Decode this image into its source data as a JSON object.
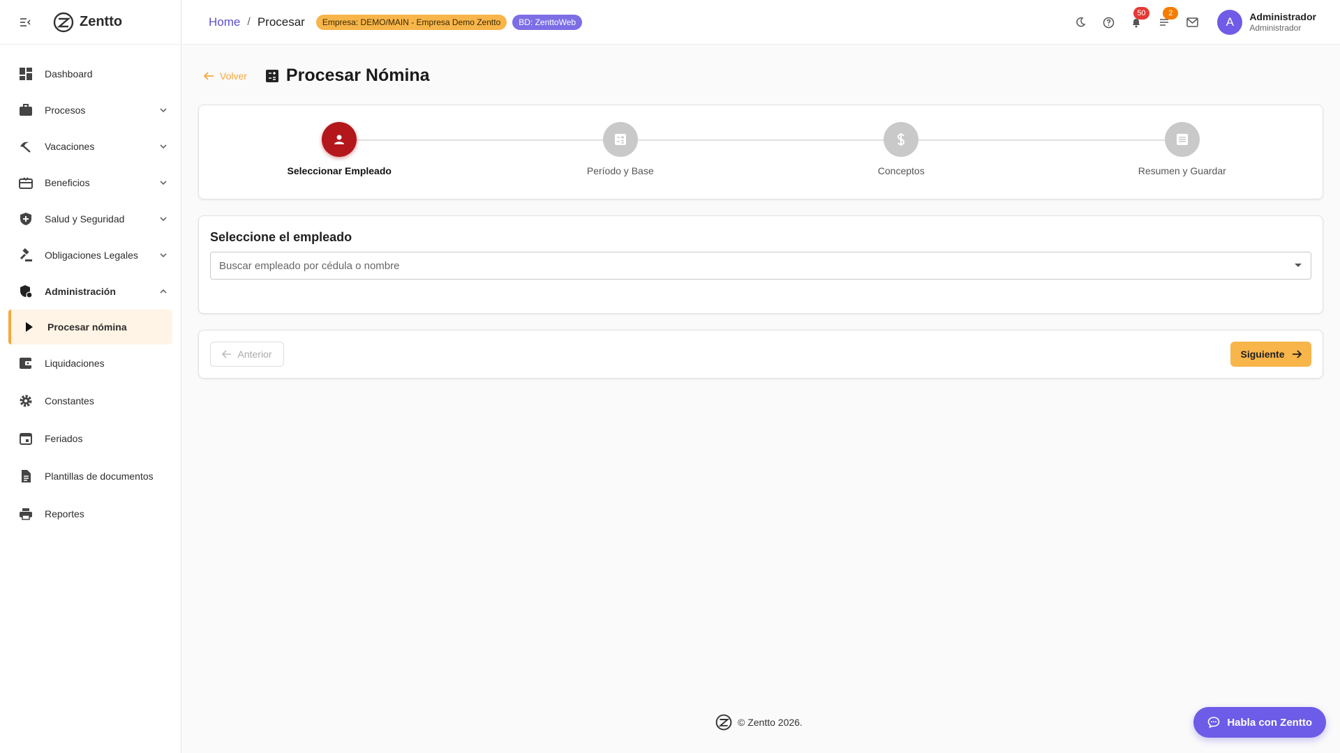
{
  "app": {
    "name": "Zentto"
  },
  "header": {
    "breadcrumb": {
      "home": "Home",
      "sep": "/",
      "current": "Procesar"
    },
    "badge_empresa": "Empresa: DEMO/MAIN - Empresa Demo Zentto",
    "badge_bd": "BD: ZenttoWeb",
    "notifications_count": "50",
    "tasks_count": "2",
    "user": {
      "initial": "A",
      "name": "Administrador",
      "role": "Administrador"
    }
  },
  "sidebar": {
    "items": [
      {
        "label": "Dashboard",
        "icon": "dashboard-icon"
      },
      {
        "label": "Procesos",
        "icon": "briefcase-icon"
      },
      {
        "label": "Vacaciones",
        "icon": "beach-icon"
      },
      {
        "label": "Beneficios",
        "icon": "gift-card-icon"
      },
      {
        "label": "Salud y Seguridad",
        "icon": "shield-icon"
      },
      {
        "label": "Obligaciones Legales",
        "icon": "gavel-icon"
      },
      {
        "label": "Administración",
        "icon": "admin-shield-icon"
      },
      {
        "label": "Procesar nómina",
        "icon": "play-icon"
      },
      {
        "label": "Liquidaciones",
        "icon": "wallet-icon"
      },
      {
        "label": "Constantes",
        "icon": "gear-icon"
      },
      {
        "label": "Feriados",
        "icon": "calendar-icon"
      },
      {
        "label": "Plantillas de documentos",
        "icon": "document-icon"
      },
      {
        "label": "Reportes",
        "icon": "printer-icon"
      }
    ]
  },
  "page": {
    "back_label": "Volver",
    "title": "Procesar Nómina"
  },
  "stepper": {
    "active_index": 0,
    "steps": [
      {
        "label": "Seleccionar Empleado",
        "icon": "person-icon"
      },
      {
        "label": "Período y Base",
        "icon": "calculator-icon"
      },
      {
        "label": "Conceptos",
        "icon": "dollar-icon"
      },
      {
        "label": "Resumen y Guardar",
        "icon": "list-icon"
      }
    ]
  },
  "select_employee": {
    "title": "Seleccione el empleado",
    "placeholder": "Buscar empleado por cédula o nombre"
  },
  "wizard_nav": {
    "prev_label": "Anterior",
    "next_label": "Siguiente"
  },
  "footer": {
    "text": "© Zentto 2026."
  },
  "chat": {
    "label": "Habla con Zentto"
  },
  "colors": {
    "accent": "#f7b54a",
    "brand_purple": "#6c5ce7",
    "active_step": "#b3161b"
  }
}
